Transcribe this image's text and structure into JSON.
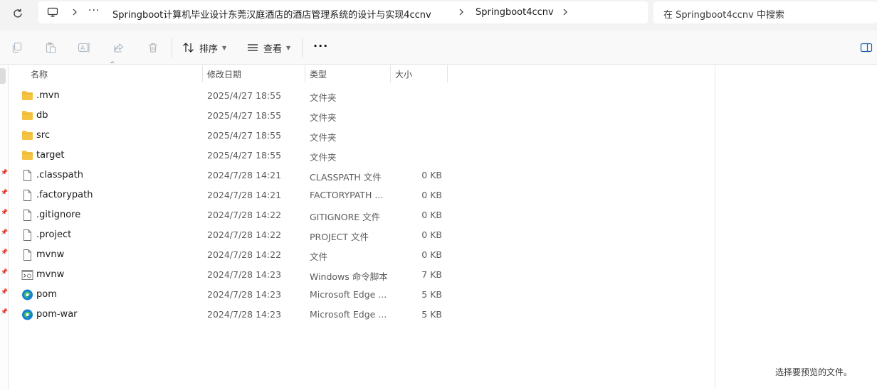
{
  "breadcrumb": {
    "more": "···",
    "items": [
      "Springboot计算机毕业设计东莞汉庭酒店的酒店管理系统的设计与实现4ccnv",
      "Springboot4ccnv"
    ]
  },
  "search": {
    "placeholder": "在 Springboot4ccnv 中搜索"
  },
  "toolbar": {
    "sort_label": "排序",
    "view_label": "查看",
    "more_label": "···"
  },
  "columns": {
    "name": "名称",
    "date": "修改日期",
    "type": "类型",
    "size": "大小"
  },
  "files": [
    {
      "name": ".mvn",
      "date": "2025/4/27 18:55",
      "type": "文件夹",
      "size": "",
      "icon": "folder-icon"
    },
    {
      "name": "db",
      "date": "2025/4/27 18:55",
      "type": "文件夹",
      "size": "",
      "icon": "folder-icon"
    },
    {
      "name": "src",
      "date": "2025/4/27 18:55",
      "type": "文件夹",
      "size": "",
      "icon": "folder-icon"
    },
    {
      "name": "target",
      "date": "2025/4/27 18:55",
      "type": "文件夹",
      "size": "",
      "icon": "folder-icon"
    },
    {
      "name": ".classpath",
      "date": "2024/7/28 14:21",
      "type": "CLASSPATH 文件",
      "size": "0 KB",
      "icon": "file-icon"
    },
    {
      "name": ".factorypath",
      "date": "2024/7/28 14:21",
      "type": "FACTORYPATH ...",
      "size": "0 KB",
      "icon": "file-icon"
    },
    {
      "name": ".gitignore",
      "date": "2024/7/28 14:22",
      "type": "GITIGNORE 文件",
      "size": "0 KB",
      "icon": "file-icon"
    },
    {
      "name": ".project",
      "date": "2024/7/28 14:22",
      "type": "PROJECT 文件",
      "size": "0 KB",
      "icon": "file-icon"
    },
    {
      "name": "mvnw",
      "date": "2024/7/28 14:22",
      "type": "文件",
      "size": "0 KB",
      "icon": "file-icon"
    },
    {
      "name": "mvnw",
      "date": "2024/7/28 14:23",
      "type": "Windows 命令脚本",
      "size": "7 KB",
      "icon": "cmd-script-icon"
    },
    {
      "name": "pom",
      "date": "2024/7/28 14:23",
      "type": "Microsoft Edge ...",
      "size": "5 KB",
      "icon": "edge-icon"
    },
    {
      "name": "pom-war",
      "date": "2024/7/28 14:23",
      "type": "Microsoft Edge ...",
      "size": "5 KB",
      "icon": "edge-icon"
    }
  ],
  "preview": {
    "message": "选择要预览的文件。"
  },
  "colors": {
    "folder": "#f5c342",
    "edge_blue": "#1380d6",
    "edge_green": "#3fbf5f"
  }
}
